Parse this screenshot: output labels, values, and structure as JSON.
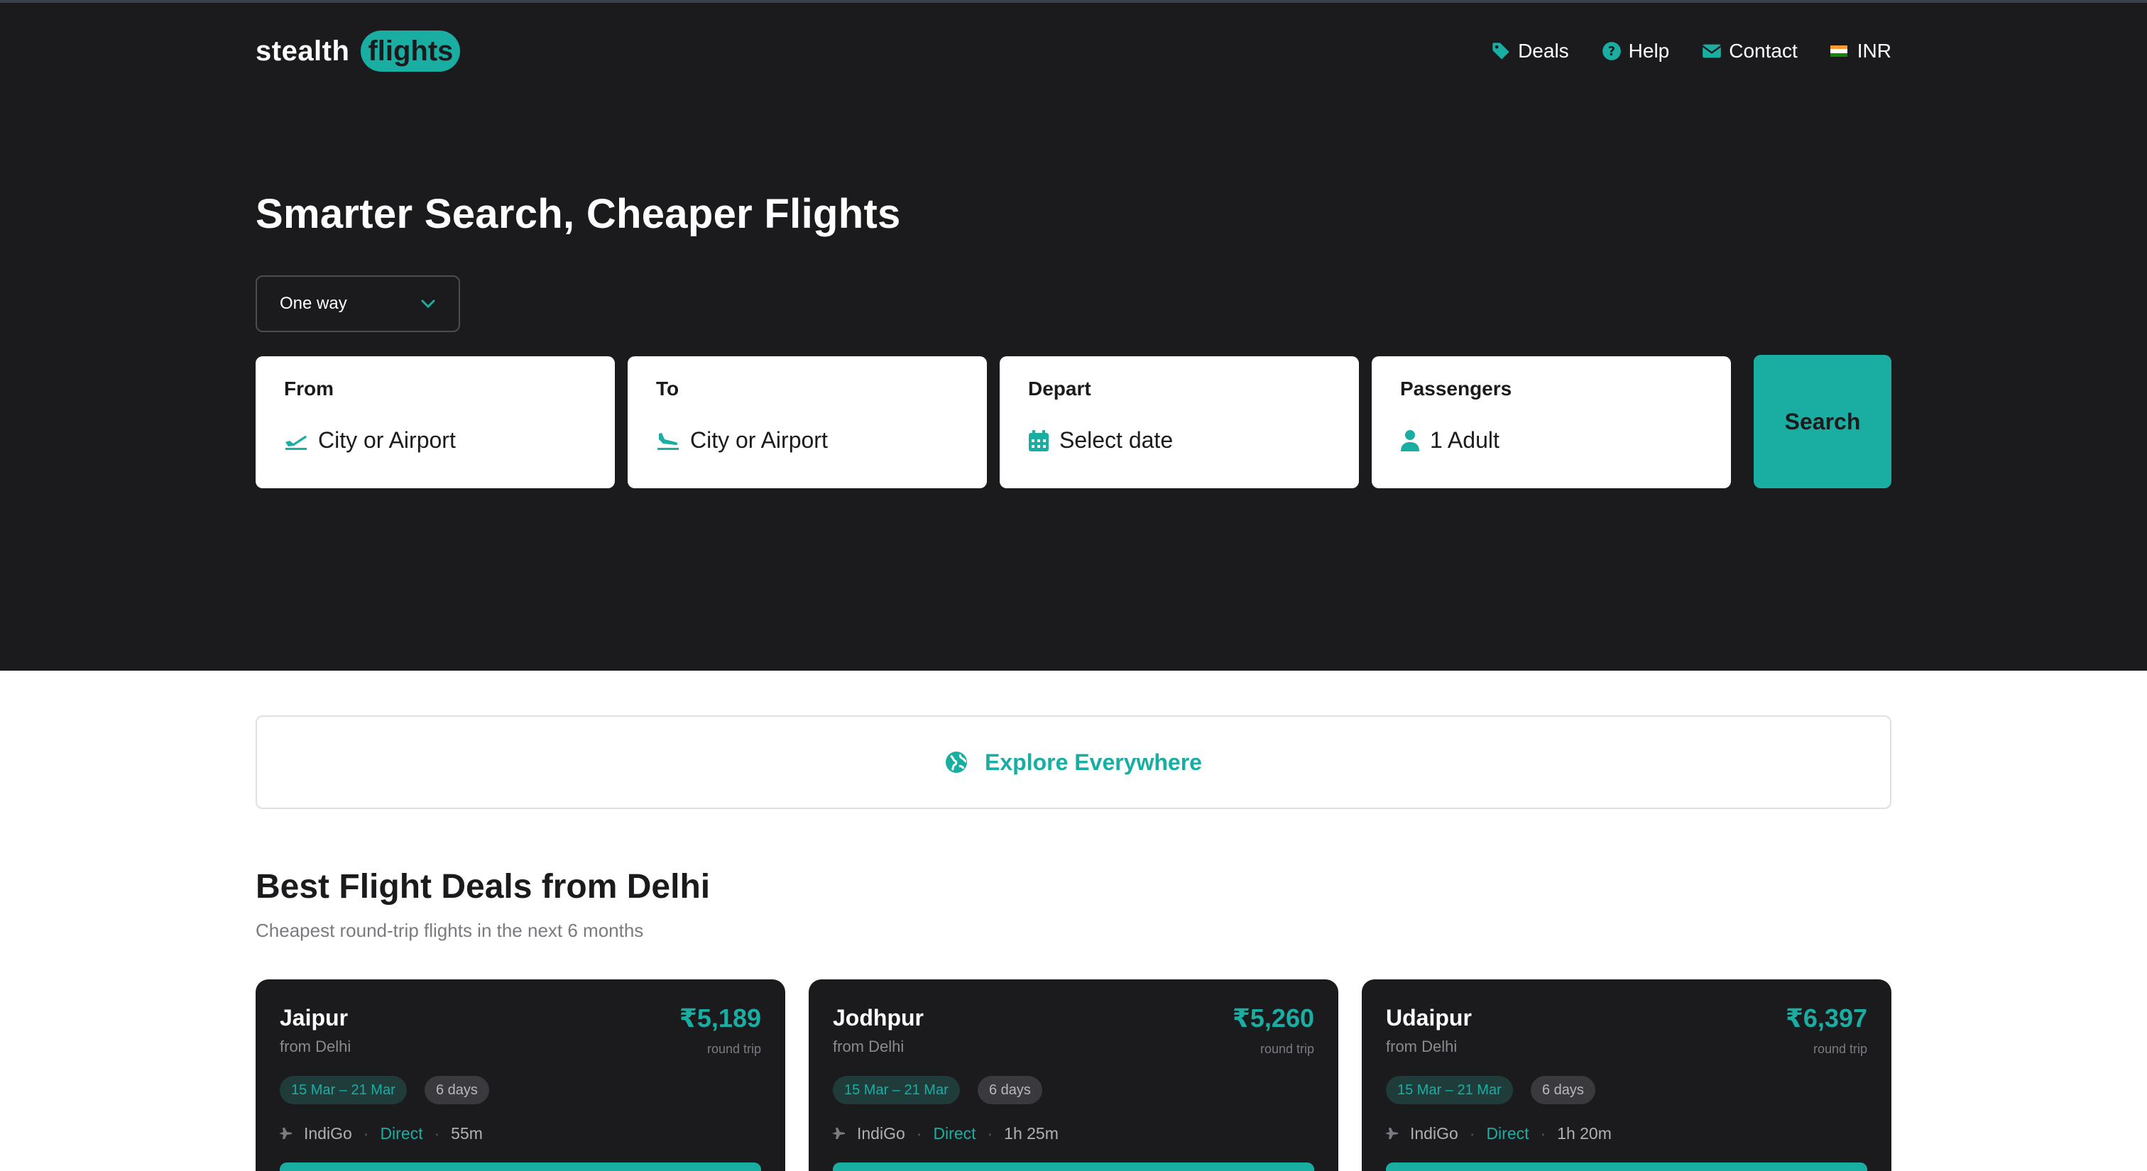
{
  "header": {
    "logo_word": "stealth",
    "logo_pill": "flights",
    "nav": [
      {
        "label": "Deals",
        "icon": "tag-icon"
      },
      {
        "label": "Help",
        "icon": "help-circle-icon"
      },
      {
        "label": "Contact",
        "icon": "mail-icon"
      },
      {
        "label": "INR",
        "icon": "india-flag-icon"
      }
    ]
  },
  "hero": {
    "headline": "Smarter Search, Cheaper Flights",
    "trip_type": "One way",
    "fields": {
      "from": {
        "label": "From",
        "placeholder": "City or Airport",
        "icon": "plane-departure-icon"
      },
      "to": {
        "label": "To",
        "placeholder": "City or Airport",
        "icon": "plane-arrival-icon"
      },
      "depart": {
        "label": "Depart",
        "placeholder": "Select date",
        "icon": "calendar-icon"
      },
      "passengers": {
        "label": "Passengers",
        "value": "1 Adult",
        "icon": "user-icon"
      }
    },
    "search_label": "Search"
  },
  "explore": {
    "label": "Explore Everywhere",
    "icon": "globe-icon"
  },
  "deals": {
    "title": "Best Flight Deals from Delhi",
    "subtitle": "Cheapest round-trip flights in the next 6 months",
    "cards": [
      {
        "city": "Jaipur",
        "from": "from Delhi",
        "price": "₹5,189",
        "trip": "round trip",
        "dates": "15 Mar – 21 Mar",
        "days": "6 days",
        "airline": "IndiGo",
        "stops": "Direct",
        "duration": "55m"
      },
      {
        "city": "Jodhpur",
        "from": "from Delhi",
        "price": "₹5,260",
        "trip": "round trip",
        "dates": "15 Mar – 21 Mar",
        "days": "6 days",
        "airline": "IndiGo",
        "stops": "Direct",
        "duration": "1h 25m"
      },
      {
        "city": "Udaipur",
        "from": "from Delhi",
        "price": "₹6,397",
        "trip": "round trip",
        "dates": "15 Mar – 21 Mar",
        "days": "6 days",
        "airline": "IndiGo",
        "stops": "Direct",
        "duration": "1h 20m"
      }
    ]
  },
  "colors": {
    "accent": "#1aaea3",
    "dark": "#1b1b1e",
    "muted": "#7a7a80"
  }
}
